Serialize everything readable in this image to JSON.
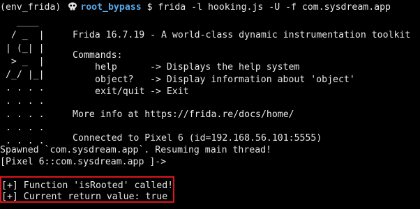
{
  "prompt": {
    "env": "(env_frida)",
    "user": "root_bypass",
    "symbol": "$",
    "command": "frida -l hooking.js -U -f com.sysdream.app"
  },
  "banner": {
    "logo_lines": [
      "   ____",
      "  / _  |",
      " | (_| |",
      "  > _  |",
      " /_/ |_|",
      " . . . .",
      " . . . .",
      " . . . .",
      " . . . .",
      " . . . .",
      " . . . .",
      " . . . ."
    ],
    "version_text": "Frida 16.7.19 - A world-class dynamic instrumentation toolkit",
    "commands_header": "Commands:",
    "commands": [
      {
        "name": "help",
        "desc": "-> Displays the help system"
      },
      {
        "name": "object?",
        "desc": "-> Display information about 'object'"
      },
      {
        "name": "exit/quit",
        "desc": "-> Exit"
      }
    ],
    "more_info": "More info at https://frida.re/docs/home/",
    "connected": "Connected to Pixel 6 (id=192.168.56.101:5555)"
  },
  "output": {
    "spawned": "Spawned `com.sysdream.app`. Resuming main thread!",
    "repl_prompt": "[Pixel 6::com.sysdream.app ]->",
    "hook_line1": "[+] Function 'isRooted' called!",
    "hook_line2": "[+] Current return value: true"
  },
  "colors": {
    "background": "#000000",
    "text": "#e6e6e6",
    "prompt_user": "#5aa9e6",
    "highlight_border": "#e0141e"
  },
  "icons": {
    "prompt_icon": "skull-icon"
  }
}
